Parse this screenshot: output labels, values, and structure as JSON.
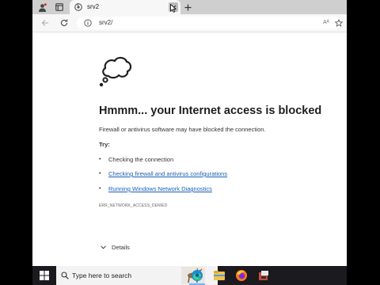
{
  "browser": {
    "tab": {
      "title": "srv2"
    },
    "address": {
      "url": "srv2/",
      "read_aloud": "Aᴬ"
    }
  },
  "error": {
    "heading": "Hmmm... your Internet access is blocked",
    "description": "Firewall or antivirus software may have blocked the connection.",
    "try_label": "Try:",
    "suggestions": [
      {
        "text": "Checking the connection",
        "is_link": false
      },
      {
        "text": "Checking firewall and antivirus configurations",
        "is_link": true
      },
      {
        "text": "Running Windows Network Diagnostics",
        "is_link": true
      }
    ],
    "code": "ERR_NETWORK_ACCESS_DENIED",
    "details_label": "Details"
  },
  "taskbar": {
    "search_placeholder": "Type here to search",
    "apps": [
      "edge-icon",
      "file-explorer-icon",
      "firefox-icon",
      "app-icon"
    ]
  },
  "colors": {
    "link": "#1a5fb4",
    "heading": "#1f1f1f",
    "taskbar": "#1a1a1f"
  }
}
